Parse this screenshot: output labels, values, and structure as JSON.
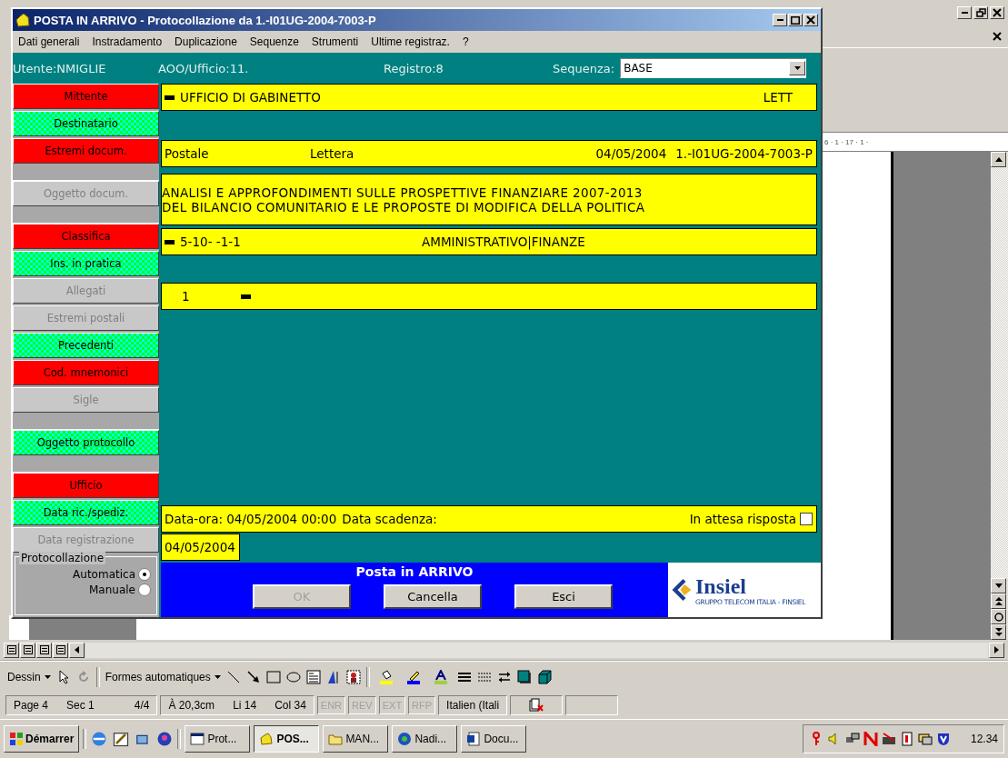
{
  "dialog": {
    "title": "POSTA IN ARRIVO - Protocollazione da 1.-I01UG-2004-7003-P",
    "menu": [
      "Dati generali",
      "Instradamento",
      "Duplicazione",
      "Sequenze",
      "Strumenti",
      "Ultime registraz.",
      "?"
    ],
    "info": {
      "utente": "Utente:NMIGLIE",
      "ufficio": "AOO/Ufficio:11.",
      "registro": "Registro:8",
      "sequenza_label": "Sequenza:",
      "sequenza": "BASE"
    },
    "sections": [
      {
        "label": "Mittente",
        "kind": "required",
        "disabled": false
      },
      {
        "label": "Destinatario",
        "kind": "optional",
        "disabled": false
      },
      {
        "label": "Estremi docum.",
        "kind": "required",
        "disabled": false
      },
      {
        "kind": "gap"
      },
      {
        "label": "Oggetto docum.",
        "kind": "plain",
        "disabled": true
      },
      {
        "kind": "gap"
      },
      {
        "label": "Classifica",
        "kind": "required",
        "disabled": false
      },
      {
        "label": "Ins. in pratica",
        "kind": "optional",
        "disabled": false
      },
      {
        "label": "Allegati",
        "kind": "plain",
        "disabled": true
      },
      {
        "label": "Estremi postali",
        "kind": "plain",
        "disabled": true
      },
      {
        "label": "Precedenti",
        "kind": "optional",
        "disabled": false
      },
      {
        "label": "Cod. mnemonici",
        "kind": "required",
        "disabled": false
      },
      {
        "label": "Sigle",
        "kind": "plain",
        "disabled": true
      },
      {
        "kind": "gap"
      },
      {
        "label": "Oggetto protocollo",
        "kind": "optional",
        "disabled": false
      },
      {
        "kind": "gap"
      },
      {
        "label": "Ufficio",
        "kind": "required",
        "disabled": false
      },
      {
        "label": "Data ric./spediz.",
        "kind": "optional",
        "disabled": false
      },
      {
        "label": "Data registrazione",
        "kind": "plain",
        "disabled": true
      }
    ],
    "mittente": {
      "name": "UFFICIO DI GABINETTO",
      "type": "LETT"
    },
    "estremi": {
      "mezzo": "Postale",
      "tipo": "Lettera",
      "data": "04/05/2004",
      "numero": "1.-I01UG-2004-7003-P"
    },
    "oggetto": [
      "ANALISI E APPROFONDIMENTI SULLE PROSPETTIVE FINANZIARE 2007-2013",
      "DEL BILANCIO COMUNITARIO E LE PROPOSTE DI MODIFICA DELLA POLITICA"
    ],
    "classifica": {
      "code": "5-10- -1-1",
      "description": "AMMINISTRATIVO|FINANZE"
    },
    "allegati": {
      "count": "1"
    },
    "date_row": {
      "data_ora": "Data-ora: 04/05/2004 00:00",
      "scadenza": "Data scadenza:",
      "attesa": "In attesa risposta",
      "attesa_checked": false
    },
    "data_registrazione": "04/05/2004",
    "protocollazione": {
      "title": "Protocollazione",
      "options": [
        {
          "label": "Automatica",
          "selected": true
        },
        {
          "label": "Manuale",
          "selected": false
        }
      ]
    },
    "panel_title": "Posta in ARRIVO",
    "buttons": [
      {
        "label": "OK",
        "disabled": true
      },
      {
        "label": "Cancella",
        "disabled": false
      },
      {
        "label": "Esci",
        "disabled": false
      }
    ],
    "logo": {
      "name": "Insiel",
      "tagline": "GRUPPO TELECOM ITALIA - FINSIEL"
    }
  },
  "word": {
    "ruler": "6 · 1 · 17 · 1 ·",
    "drawing": {
      "dessin": "Dessin",
      "formes": "Formes automatiques"
    },
    "status": {
      "page": "Page 4",
      "sec": "Sec 1",
      "pages": "4/4",
      "at": "À 20,3cm",
      "line": "Li 14",
      "col": "Col 34",
      "modes": [
        {
          "label": "ENR",
          "on": false
        },
        {
          "label": "REV",
          "on": false
        },
        {
          "label": "EXT",
          "on": false
        },
        {
          "label": "RFP",
          "on": false
        }
      ],
      "language": "Italien (Itali"
    }
  },
  "taskbar": {
    "start": "Démarrer",
    "tasks": [
      {
        "label": "Prot...",
        "kind": "window",
        "selected": false
      },
      {
        "label": "POS...",
        "kind": "app",
        "selected": true
      },
      {
        "label": "MAN...",
        "kind": "folder",
        "selected": false
      },
      {
        "label": "Nadi...",
        "kind": "globe",
        "selected": false
      },
      {
        "label": "Docu...",
        "kind": "word",
        "selected": false
      }
    ],
    "clock": "12.34"
  }
}
